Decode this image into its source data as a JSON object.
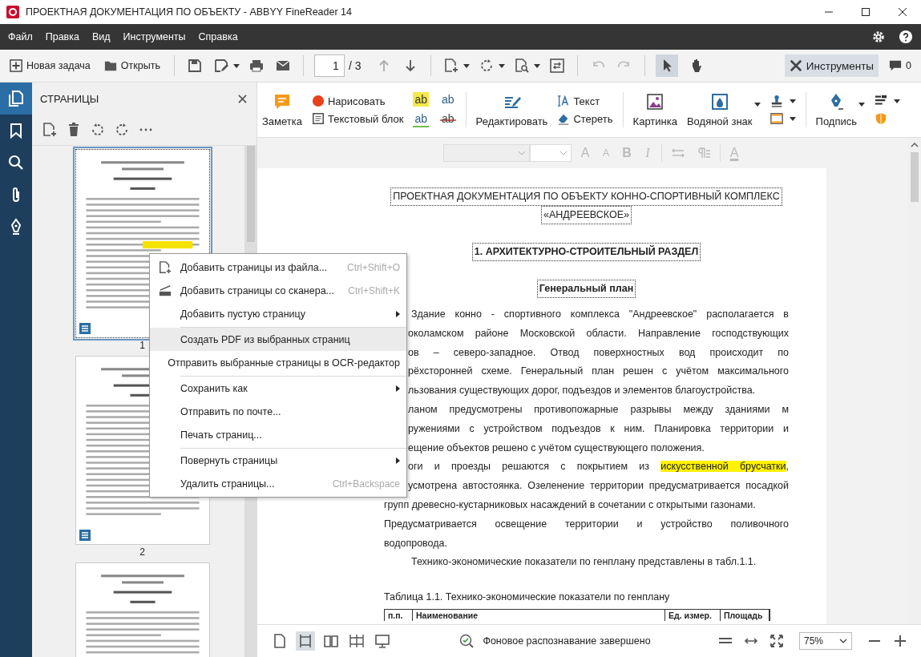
{
  "window": {
    "title": "ПРОЕКТНАЯ ДОКУМЕНТАЦИЯ ПО ОБЪЕКТУ - ABBYY FineReader 14"
  },
  "menu": [
    "Файл",
    "Правка",
    "Вид",
    "Инструменты",
    "Справка"
  ],
  "toolbar": {
    "new_task": "Новая задача",
    "open": "Открыть",
    "page_number": "1",
    "page_total": "/ 3",
    "tools": "Инструменты",
    "tools_selected": true,
    "comments_count": "0",
    "modes": [
      {
        "kind": "pointer",
        "selected": true
      },
      {
        "kind": "hand",
        "selected": false
      }
    ]
  },
  "rail": [
    {
      "kind": "pages",
      "selected": true
    },
    {
      "kind": "bookmarks",
      "selected": false
    },
    {
      "kind": "search",
      "selected": false
    },
    {
      "kind": "attachments",
      "selected": false
    },
    {
      "kind": "signatures",
      "selected": false
    }
  ],
  "pages_panel": {
    "title": "СТРАНИЦЫ",
    "thumbnails": [
      {
        "number": "1",
        "selected": true,
        "highlight": true
      },
      {
        "number": "2",
        "selected": false,
        "highlight": false
      },
      {
        "selected": false,
        "highlight": false
      }
    ]
  },
  "ribbon": {
    "note": "Заметка",
    "draw": "Нарисовать",
    "text_block": "Текстовый блок",
    "edit": "Редактировать",
    "text": "Текст",
    "erase": "Стереть",
    "picture": "Картинка",
    "watermark": "Водяной знак",
    "signature": "Подпись",
    "markup": [
      {
        "kind": "highlight",
        "glyph": "ab"
      },
      {
        "kind": "insert",
        "glyph": "ab"
      },
      {
        "kind": "underline",
        "glyph": "ab"
      },
      {
        "kind": "strike",
        "glyph": "ab"
      }
    ]
  },
  "format_bar": {
    "disabled": true,
    "glyphs": [
      {
        "kind": "grow",
        "glyph": "A"
      },
      {
        "kind": "shrink",
        "glyph": "A"
      },
      {
        "kind": "bold",
        "glyph": "B"
      },
      {
        "kind": "italic",
        "glyph": "I"
      },
      {
        "kind": "color",
        "glyph": "A"
      }
    ]
  },
  "context_menu": [
    {
      "kind": "add-file",
      "label": "Добавить страницы из файла...",
      "shortcut": "Ctrl+Shift+O",
      "submenu": false,
      "highlighted": false,
      "separator_after": false
    },
    {
      "kind": "scanner",
      "label": "Добавить страницы со сканера...",
      "shortcut": "Ctrl+Shift+K",
      "submenu": false,
      "highlighted": false,
      "separator_after": false
    },
    {
      "kind": "plain",
      "label": "Добавить пустую страницу",
      "submenu": true,
      "highlighted": false,
      "separator_after": true
    },
    {
      "kind": "plain",
      "label": "Создать PDF из выбранных страниц",
      "submenu": false,
      "highlighted": true,
      "separator_after": false
    },
    {
      "kind": "plain",
      "label": "Отправить выбранные страницы в OCR-редактор",
      "submenu": false,
      "highlighted": false,
      "separator_after": true
    },
    {
      "kind": "plain",
      "label": "Сохранить как",
      "submenu": true,
      "highlighted": false,
      "separator_after": false
    },
    {
      "kind": "plain",
      "label": "Отправить по почте...",
      "submenu": false,
      "highlighted": false,
      "separator_after": false
    },
    {
      "kind": "plain",
      "label": "Печать страниц...",
      "submenu": false,
      "highlighted": false,
      "separator_after": true
    },
    {
      "kind": "plain",
      "label": "Повернуть страницы",
      "submenu": true,
      "highlighted": false,
      "separator_after": false
    },
    {
      "kind": "plain",
      "label": "Удалить страницы...",
      "shortcut": "Ctrl+Backspace",
      "submenu": false,
      "highlighted": false,
      "separator_after": false
    }
  ],
  "document": {
    "lines": [
      {
        "kind": "center",
        "text": "ПРОЕКТНАЯ ДОКУМЕНТАЦИЯ ПО ОБЪЕКТУ КОННО-СПОРТИВНЫЙ КОМПЛЕКС"
      },
      {
        "kind": "center",
        "text": "«АНДРЕЕВСКОЕ»"
      },
      {
        "kind": "heading",
        "text": "1.  АРХИТЕКТУРНО-СТРОИТЕЛЬНЫЙ РАЗДЕЛ"
      },
      {
        "kind": "heading",
        "text": "Генеральный  план"
      },
      {
        "kind": "indent",
        "text": "Здание конно - спортивного комплекса  \"Андреевское\" располагается в"
      },
      {
        "kind": "cut",
        "text": "околамском районе Московской области.  Направление господствующих"
      },
      {
        "kind": "cut",
        "text": "ов  –  северо-западное.   Отвод  поверхностных  вод  происходит  по"
      },
      {
        "kind": "cut",
        "text": "рёхсторонней схеме. Генеральный план решен с учётом максимального"
      },
      {
        "kind": "cut-last",
        "text": "льзования существующих дорог, подъездов и элементов благоустройства."
      },
      {
        "kind": "cut",
        "text": "ланом предусмотрены противопожарные разрывы между зданиями м"
      },
      {
        "kind": "cut",
        "text": "ружениями с устройством подъездов к ним. Планировка территории и"
      },
      {
        "kind": "cut-last",
        "text": "ещение объектов решено с учётом существующего положения."
      },
      {
        "kind": "cut",
        "parts": [
          {
            "text": "оги и проезды решаются с покрытием из ",
            "highlighted": false
          },
          {
            "text": "искусственной брусчатки",
            "highlighted": true
          },
          {
            "text": ",",
            "highlighted": false
          }
        ]
      },
      {
        "kind": "cut",
        "text": "усмотрена автостоянка. Озеленение территории предусматривается посадкой"
      },
      {
        "kind": "last",
        "text": "групп древесно-кустарниковых насаждений в сочетании с открытыми газонами."
      },
      {
        "kind": "justify",
        "text": "Предусматривается освещение территории и устройство поливочного"
      },
      {
        "kind": "last",
        "text": "водопровода."
      },
      {
        "kind": "indent-last",
        "text": "Технико-экономические показатели по генплану представлены в табл.1.1."
      },
      {
        "kind": "caption",
        "text": "Таблица 1.1. Технико-экономические показатели по генплану"
      }
    ],
    "table_header": [
      "п.п.",
      "Наименование",
      "Ед. измер.",
      "Площадь"
    ]
  },
  "status_bar": {
    "message": "Фоновое распознавание завершено",
    "zoom": "75%"
  }
}
